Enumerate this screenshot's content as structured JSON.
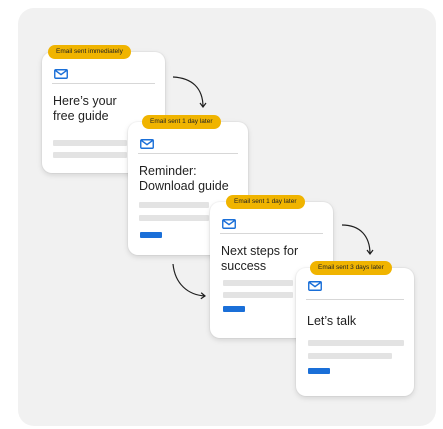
{
  "cards": [
    {
      "badge": "Email sent immediately",
      "title_lines": [
        "Here’s your",
        "free guide"
      ],
      "icon": "mail-icon"
    },
    {
      "badge": "Email sent 1 day later",
      "title_lines": [
        "Reminder:",
        "Download guide"
      ],
      "icon": "mail-icon"
    },
    {
      "badge": "Email sent 1 day later",
      "title_lines": [
        "Next steps for",
        "success"
      ],
      "icon": "mail-icon"
    },
    {
      "badge": "Email sent 3 days later",
      "title_lines": [
        "Let’s talk"
      ],
      "icon": "mail-icon"
    }
  ],
  "colors": {
    "badge": "#f0b400",
    "accent": "#1a6fd8",
    "placeholder_bar": "#e3e3e3",
    "panel_bg": "#f1f1f1",
    "card_bg": "#ffffff"
  }
}
